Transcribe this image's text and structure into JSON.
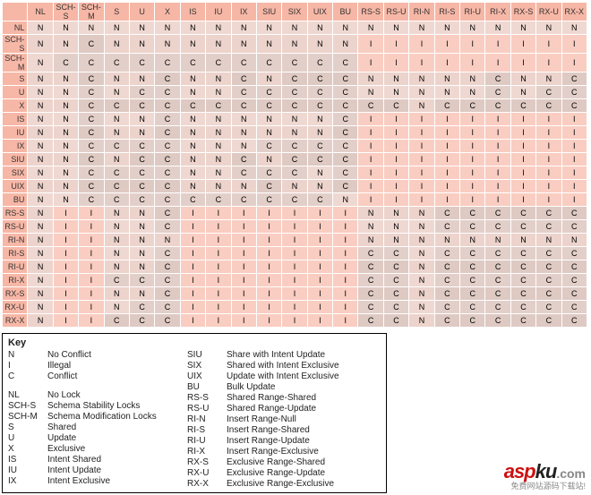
{
  "labels": [
    "NL",
    "SCH-S",
    "SCH-M",
    "S",
    "U",
    "X",
    "IS",
    "IU",
    "IX",
    "SIU",
    "SIX",
    "UIX",
    "BU",
    "RS-S",
    "RS-U",
    "RI-N",
    "RI-S",
    "RI-U",
    "RI-X",
    "RX-S",
    "RX-U",
    "RX-X"
  ],
  "matrix": [
    [
      "N",
      "N",
      "N",
      "N",
      "N",
      "N",
      "N",
      "N",
      "N",
      "N",
      "N",
      "N",
      "N",
      "N",
      "N",
      "N",
      "N",
      "N",
      "N",
      "N",
      "N",
      "N"
    ],
    [
      "N",
      "N",
      "C",
      "N",
      "N",
      "N",
      "N",
      "N",
      "N",
      "N",
      "N",
      "N",
      "N",
      "I",
      "I",
      "I",
      "I",
      "I",
      "I",
      "I",
      "I",
      "I"
    ],
    [
      "N",
      "C",
      "C",
      "C",
      "C",
      "C",
      "C",
      "C",
      "C",
      "C",
      "C",
      "C",
      "C",
      "I",
      "I",
      "I",
      "I",
      "I",
      "I",
      "I",
      "I",
      "I"
    ],
    [
      "N",
      "N",
      "C",
      "N",
      "N",
      "C",
      "N",
      "N",
      "C",
      "N",
      "C",
      "C",
      "C",
      "N",
      "N",
      "N",
      "N",
      "N",
      "C",
      "N",
      "N",
      "C"
    ],
    [
      "N",
      "N",
      "C",
      "N",
      "C",
      "C",
      "N",
      "N",
      "C",
      "C",
      "C",
      "C",
      "C",
      "N",
      "N",
      "N",
      "N",
      "N",
      "C",
      "N",
      "C",
      "C"
    ],
    [
      "N",
      "N",
      "C",
      "C",
      "C",
      "C",
      "C",
      "C",
      "C",
      "C",
      "C",
      "C",
      "C",
      "C",
      "C",
      "N",
      "C",
      "C",
      "C",
      "C",
      "C",
      "C"
    ],
    [
      "N",
      "N",
      "C",
      "N",
      "N",
      "C",
      "N",
      "N",
      "N",
      "N",
      "N",
      "N",
      "C",
      "I",
      "I",
      "I",
      "I",
      "I",
      "I",
      "I",
      "I",
      "I"
    ],
    [
      "N",
      "N",
      "C",
      "N",
      "N",
      "C",
      "N",
      "N",
      "N",
      "N",
      "N",
      "N",
      "C",
      "I",
      "I",
      "I",
      "I",
      "I",
      "I",
      "I",
      "I",
      "I"
    ],
    [
      "N",
      "N",
      "C",
      "C",
      "C",
      "C",
      "N",
      "N",
      "N",
      "C",
      "C",
      "C",
      "C",
      "I",
      "I",
      "I",
      "I",
      "I",
      "I",
      "I",
      "I",
      "I"
    ],
    [
      "N",
      "N",
      "C",
      "N",
      "C",
      "C",
      "N",
      "N",
      "C",
      "N",
      "C",
      "C",
      "C",
      "I",
      "I",
      "I",
      "I",
      "I",
      "I",
      "I",
      "I",
      "I"
    ],
    [
      "N",
      "N",
      "C",
      "C",
      "C",
      "C",
      "N",
      "N",
      "C",
      "C",
      "C",
      "N",
      "C",
      "I",
      "I",
      "I",
      "I",
      "I",
      "I",
      "I",
      "I",
      "I"
    ],
    [
      "N",
      "N",
      "C",
      "C",
      "C",
      "C",
      "N",
      "N",
      "N",
      "C",
      "N",
      "N",
      "C",
      "I",
      "I",
      "I",
      "I",
      "I",
      "I",
      "I",
      "I",
      "I"
    ],
    [
      "N",
      "N",
      "C",
      "C",
      "C",
      "C",
      "C",
      "C",
      "C",
      "C",
      "C",
      "C",
      "N",
      "I",
      "I",
      "I",
      "I",
      "I",
      "I",
      "I",
      "I",
      "I"
    ],
    [
      "N",
      "I",
      "I",
      "N",
      "N",
      "C",
      "I",
      "I",
      "I",
      "I",
      "I",
      "I",
      "I",
      "N",
      "N",
      "N",
      "C",
      "C",
      "C",
      "C",
      "C",
      "C"
    ],
    [
      "N",
      "I",
      "I",
      "N",
      "N",
      "C",
      "I",
      "I",
      "I",
      "I",
      "I",
      "I",
      "I",
      "N",
      "N",
      "N",
      "C",
      "C",
      "C",
      "C",
      "C",
      "C"
    ],
    [
      "N",
      "I",
      "I",
      "N",
      "N",
      "N",
      "I",
      "I",
      "I",
      "I",
      "I",
      "I",
      "I",
      "N",
      "N",
      "N",
      "N",
      "N",
      "N",
      "N",
      "N",
      "N"
    ],
    [
      "N",
      "I",
      "I",
      "N",
      "N",
      "C",
      "I",
      "I",
      "I",
      "I",
      "I",
      "I",
      "I",
      "C",
      "C",
      "N",
      "C",
      "C",
      "C",
      "C",
      "C",
      "C"
    ],
    [
      "N",
      "I",
      "I",
      "N",
      "N",
      "C",
      "I",
      "I",
      "I",
      "I",
      "I",
      "I",
      "I",
      "C",
      "C",
      "N",
      "C",
      "C",
      "C",
      "C",
      "C",
      "C"
    ],
    [
      "N",
      "I",
      "I",
      "C",
      "C",
      "C",
      "I",
      "I",
      "I",
      "I",
      "I",
      "I",
      "I",
      "C",
      "C",
      "N",
      "C",
      "C",
      "C",
      "C",
      "C",
      "C"
    ],
    [
      "N",
      "I",
      "I",
      "N",
      "N",
      "C",
      "I",
      "I",
      "I",
      "I",
      "I",
      "I",
      "I",
      "C",
      "C",
      "N",
      "C",
      "C",
      "C",
      "C",
      "C",
      "C"
    ],
    [
      "N",
      "I",
      "I",
      "N",
      "C",
      "C",
      "I",
      "I",
      "I",
      "I",
      "I",
      "I",
      "I",
      "C",
      "C",
      "N",
      "C",
      "C",
      "C",
      "C",
      "C",
      "C"
    ],
    [
      "N",
      "I",
      "I",
      "C",
      "C",
      "C",
      "I",
      "I",
      "I",
      "I",
      "I",
      "I",
      "I",
      "C",
      "C",
      "N",
      "C",
      "C",
      "C",
      "C",
      "C",
      "C"
    ]
  ],
  "key": {
    "title": "Key",
    "left": [
      {
        "code": "N",
        "desc": "No Conflict"
      },
      {
        "code": "I",
        "desc": "Illegal"
      },
      {
        "code": "C",
        "desc": "Conflict"
      },
      {
        "spacer": true
      },
      {
        "code": "NL",
        "desc": "No Lock"
      },
      {
        "code": "SCH-S",
        "desc": "Schema Stability Locks"
      },
      {
        "code": "SCH-M",
        "desc": "Schema Modification Locks"
      },
      {
        "code": "S",
        "desc": "Shared"
      },
      {
        "code": "U",
        "desc": "Update"
      },
      {
        "code": "X",
        "desc": "Exclusive"
      },
      {
        "code": "IS",
        "desc": "Intent Shared"
      },
      {
        "code": "IU",
        "desc": "Intent Update"
      },
      {
        "code": "IX",
        "desc": "Intent Exclusive"
      }
    ],
    "right": [
      {
        "code": "SIU",
        "desc": "Share with Intent Update"
      },
      {
        "code": "SIX",
        "desc": "Shared with Intent Exclusive"
      },
      {
        "code": "UIX",
        "desc": "Update with Intent Exclusive"
      },
      {
        "code": "BU",
        "desc": "Bulk Update"
      },
      {
        "code": "RS-S",
        "desc": "Shared Range-Shared"
      },
      {
        "code": "RS-U",
        "desc": "Shared Range-Update"
      },
      {
        "code": "RI-N",
        "desc": "Insert Range-Null"
      },
      {
        "code": "RI-S",
        "desc": "Insert Range-Shared"
      },
      {
        "code": "RI-U",
        "desc": "Insert Range-Update"
      },
      {
        "code": "RI-X",
        "desc": "Insert Range-Exclusive"
      },
      {
        "code": "RX-S",
        "desc": "Exclusive Range-Shared"
      },
      {
        "code": "RX-U",
        "desc": "Exclusive Range-Update"
      },
      {
        "code": "RX-X",
        "desc": "Exclusive Range-Exclusive"
      }
    ]
  },
  "watermark": {
    "brand1": "asp",
    "brand2": "ku",
    "brand3": ".com",
    "tagline": "免费网站源码下载站!"
  }
}
